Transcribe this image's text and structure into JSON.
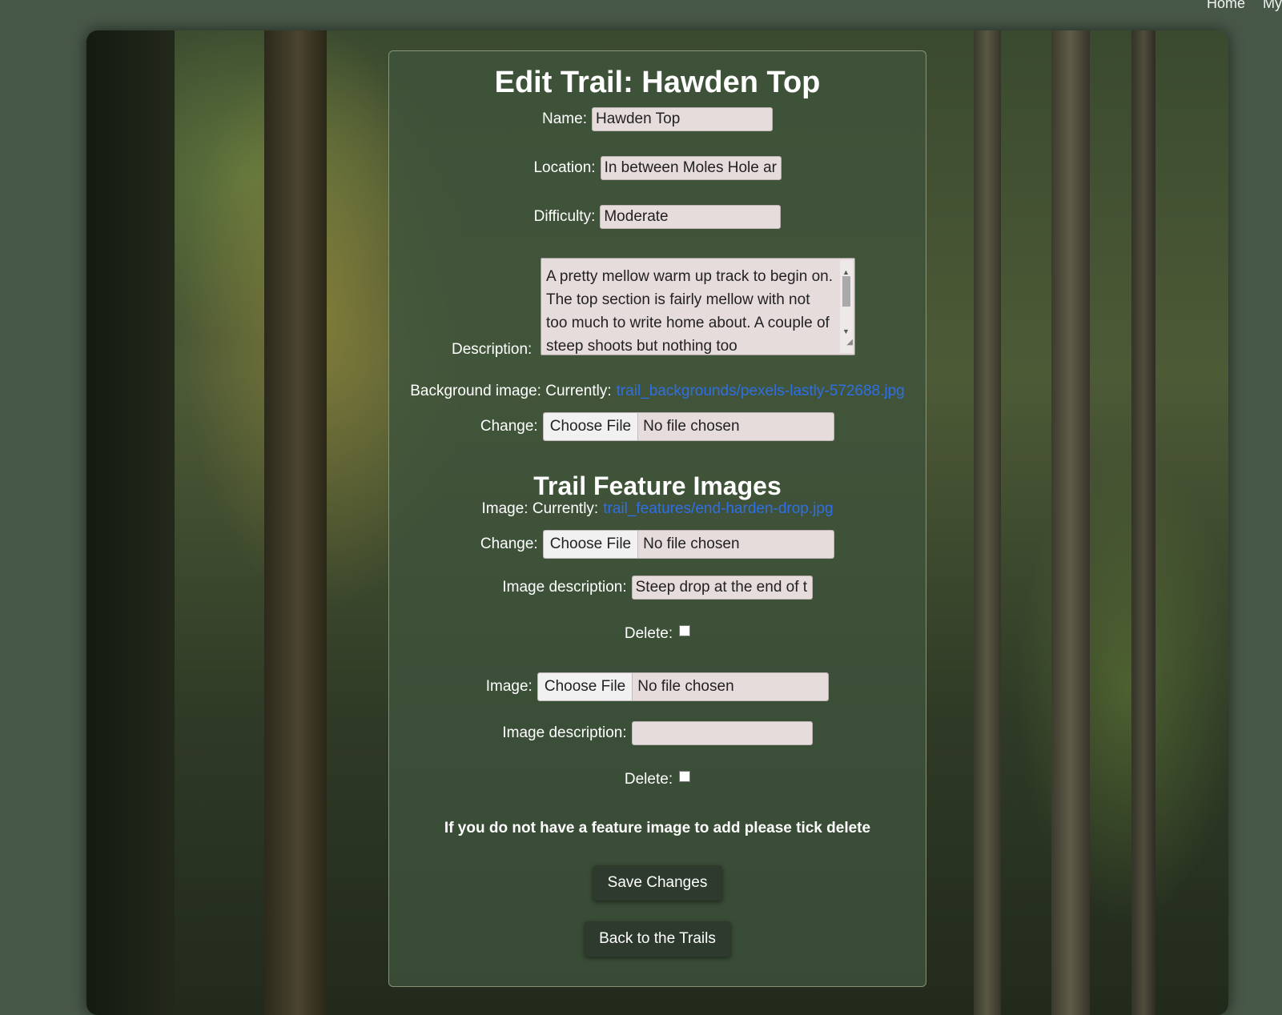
{
  "nav": {
    "home": "Home",
    "my": "My"
  },
  "form": {
    "title": "Edit Trail: Hawden Top",
    "name_label": "Name:",
    "name_value": "Hawden Top",
    "location_label": "Location:",
    "location_value": "In between Moles Hole ar",
    "difficulty_label": "Difficulty:",
    "difficulty_value": "Moderate",
    "description_label": "Description:",
    "description_value": "A pretty mellow warm up track to begin on. The top section is fairly mellow with not too much to write home about. A couple of steep shoots but nothing too",
    "bg_label": "Background image: Currently:",
    "bg_link": "trail_backgrounds/pexels-lastly-572688.jpg",
    "change_label": "Change:",
    "choose_file": "Choose File",
    "no_file": "No file chosen"
  },
  "features": {
    "heading": "Trail Feature Images",
    "image1_label": "Image: Currently:",
    "image1_link": "trail_features/end-harden-drop.jpg",
    "change_label": "Change:",
    "image_desc_label": "Image description:",
    "image1_desc_value": "Steep drop at the end of t",
    "delete_label": "Delete:",
    "image2_label": "Image:",
    "image2_desc_value": "",
    "note": "If you do not have a feature image to add please tick delete"
  },
  "buttons": {
    "save": "Save Changes",
    "back": "Back to the Trails"
  }
}
